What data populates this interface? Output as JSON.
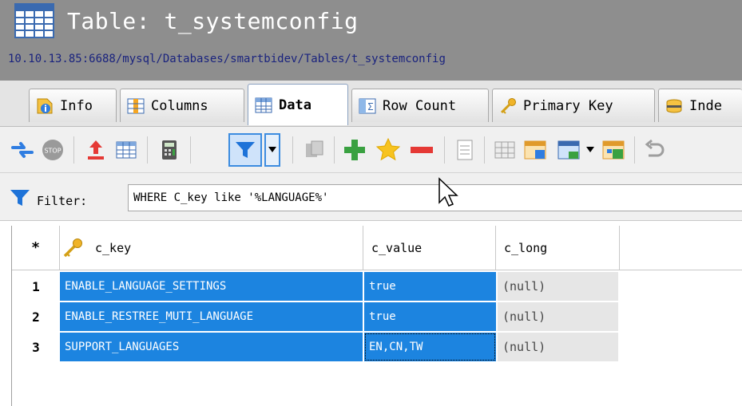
{
  "window": {
    "title": "Table: t_systemconfig",
    "path": "10.10.13.85:6688/mysql/Databases/smartbidev/Tables/t_systemconfig"
  },
  "tabs": [
    {
      "label": "Info",
      "icon": "info-icon",
      "active": false
    },
    {
      "label": "Columns",
      "icon": "columns-icon",
      "active": false
    },
    {
      "label": "Data",
      "icon": "data-grid-icon",
      "active": true
    },
    {
      "label": "Row Count",
      "icon": "row-count-icon",
      "active": false
    },
    {
      "label": "Primary Key",
      "icon": "key-icon",
      "active": false
    },
    {
      "label": "Inde",
      "icon": "index-icon",
      "active": false
    }
  ],
  "toolbar": {
    "icons": [
      "refresh-icon",
      "stop-icon",
      "export-icon",
      "grid-icon",
      "calculator-icon",
      "filter-icon",
      "filter-dropdown-icon",
      "copy-icon",
      "add-row-icon",
      "favorite-icon",
      "delete-row-icon",
      "form-view-icon",
      "grid-view-icon",
      "chart-icon",
      "dropdown-icon",
      "apply-icon",
      "undo-icon"
    ],
    "accent_color": "#3c8ce0"
  },
  "filter": {
    "label": "Filter:",
    "value": "WHERE C_key like '%LANGUAGE%'"
  },
  "grid": {
    "star": "*",
    "columns": [
      "c_key",
      "c_value",
      "c_long"
    ],
    "rows": [
      {
        "num": "1",
        "c_key": "ENABLE_LANGUAGE_SETTINGS",
        "c_value": "true",
        "c_long": "(null)"
      },
      {
        "num": "2",
        "c_key": "ENABLE_RESTREE_MUTI_LANGUAGE",
        "c_value": "true",
        "c_long": "(null)"
      },
      {
        "num": "3",
        "c_key": "SUPPORT_LANGUAGES",
        "c_value": "EN,CN,TW",
        "c_long": "(null)"
      }
    ],
    "selection_color": "#1c84e0"
  }
}
